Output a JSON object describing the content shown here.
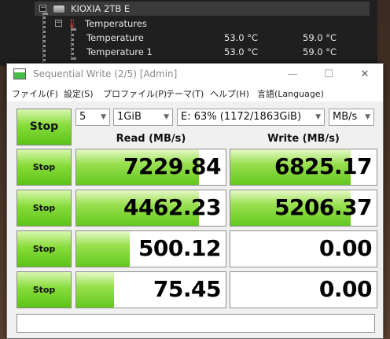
{
  "background_window": {
    "drive_label": "KIOXIA 2TB E",
    "group_label": "Temperatures",
    "rows": [
      {
        "label": "Temperature",
        "value1": "53.0 °C",
        "value2": "59.0 °C"
      },
      {
        "label": "Temperature 1",
        "value1": "53.0 °C",
        "value2": "59.0 °C"
      }
    ]
  },
  "window": {
    "title": "Sequential Write (2/5) [Admin]",
    "minimize_glyph": "—",
    "maximize_glyph": "☐",
    "close_glyph": "✕"
  },
  "menu": {
    "file": "ファイル(F)",
    "settings": "設定(S)",
    "profile": "プロファイル(P)",
    "theme": "テーマ(T)",
    "help": "ヘルプ(H)",
    "language": "言語(Language)"
  },
  "controls": {
    "stop_all_label": "Stop",
    "count_value": "5",
    "size_value": "1GiB",
    "drive_value": "E: 63% (1172/1863GiB)",
    "unit_value": "MB/s"
  },
  "headers": {
    "read": "Read (MB/s)",
    "write": "Write (MB/s)"
  },
  "rows": [
    {
      "stop_label": "Stop",
      "read": "7229.84",
      "write": "6825.17",
      "read_fill": 0.82,
      "write_fill": 0.82
    },
    {
      "stop_label": "Stop",
      "read": "4462.23",
      "write": "5206.37",
      "read_fill": 0.82,
      "write_fill": 0.82
    },
    {
      "stop_label": "Stop",
      "read": "500.12",
      "write": "0.00",
      "read_fill": 0.36,
      "write_fill": 0.0
    },
    {
      "stop_label": "Stop",
      "read": "75.45",
      "write": "0.00",
      "read_fill": 0.25,
      "write_fill": 0.0
    }
  ],
  "colors": {
    "accent_green": "#62c81e",
    "title_text": "#8a8a8a"
  }
}
